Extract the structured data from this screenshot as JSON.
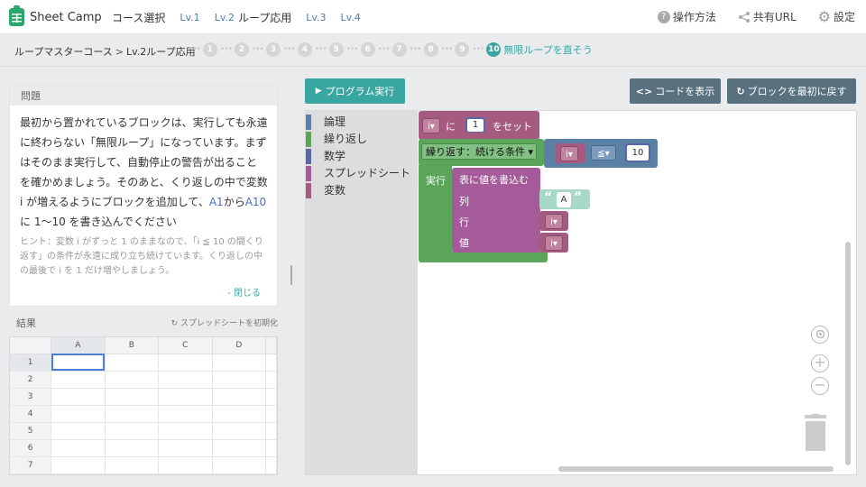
{
  "header": {
    "logo_text": "Sheet Camp",
    "nav_main": "コース選択",
    "nav_lv1": "Lv.1",
    "nav_lv2": "Lv.2",
    "nav_current": "ループ応用",
    "nav_lv3": "Lv.3",
    "nav_lv4": "Lv.4",
    "help_label": "操作方法",
    "share_label": "共有URL",
    "settings_label": "設定"
  },
  "breadcrumb": {
    "course": "ループマスターコース",
    "sep": ">",
    "level": "Lv.2ループ応用",
    "steps": [
      "1",
      "2",
      "3",
      "4",
      "5",
      "6",
      "7",
      "8",
      "9"
    ],
    "current_step": "10",
    "current_label": "無限ループを直そう"
  },
  "problem": {
    "title": "問題",
    "text_1": "最初から置かれているブロックは、実行しても永遠に終わらない「無限ループ」になっています。まずはそのまま実行して、自動停止の警告が出ることを確かめましょう。そのあと、くり返しの中で変数 i が増えるようにブロックを追加して、",
    "cell_a1": "A1",
    "text_2": "から",
    "cell_a10": "A10",
    "text_3": "に 1〜10 を書き込んでください",
    "hint": "ヒント：変数 i がずっと 1 のままなので、「i ≦ 10 の間くり返す」の条件が永遠に成り立ち続けています。くり返しの中の最後で i を 1 だけ増やしましょう。",
    "close_label": "- 閉じる"
  },
  "result": {
    "label": "結果",
    "reset_label": "スプレッドシートを初期化",
    "columns": [
      "A",
      "B",
      "C",
      "D"
    ],
    "rows": [
      "1",
      "2",
      "3",
      "4",
      "5",
      "6",
      "7"
    ]
  },
  "toolbar": {
    "run_label": "プログラム実行",
    "code_label": "コードを表示",
    "reset_blocks_label": "ブロックを最初に戻す"
  },
  "toolbox": {
    "categories": [
      {
        "label": "論理",
        "color": "#5b80a5"
      },
      {
        "label": "繰り返し",
        "color": "#5ba55b"
      },
      {
        "label": "数学",
        "color": "#5b67a5"
      },
      {
        "label": "スプレッドシート",
        "color": "#a55b99"
      },
      {
        "label": "変数",
        "color": "#a55b80"
      }
    ]
  },
  "blocks": {
    "set_var": "i",
    "set_ni": "に",
    "set_value": "1",
    "set_label": "をセット",
    "repeat_label": "繰り返す：続ける条件",
    "repeat_do": "実行",
    "cond_var": "i",
    "cond_op": "≦",
    "cond_value": "10",
    "write_label": "表に値を書込む",
    "write_col": "列",
    "write_row": "行",
    "write_val": "値",
    "col_value": "A",
    "row_var": "i",
    "val_var": "i"
  },
  "colors": {
    "accent": "#3aa6a2",
    "tool_button": "#59707f",
    "variable_block": "#a55b80",
    "loop_block": "#5ba55b",
    "logic_block": "#5b80a5",
    "sheet_block": "#a55b99",
    "math_block": "#5b67a5",
    "text_block": "#5ba58c"
  }
}
